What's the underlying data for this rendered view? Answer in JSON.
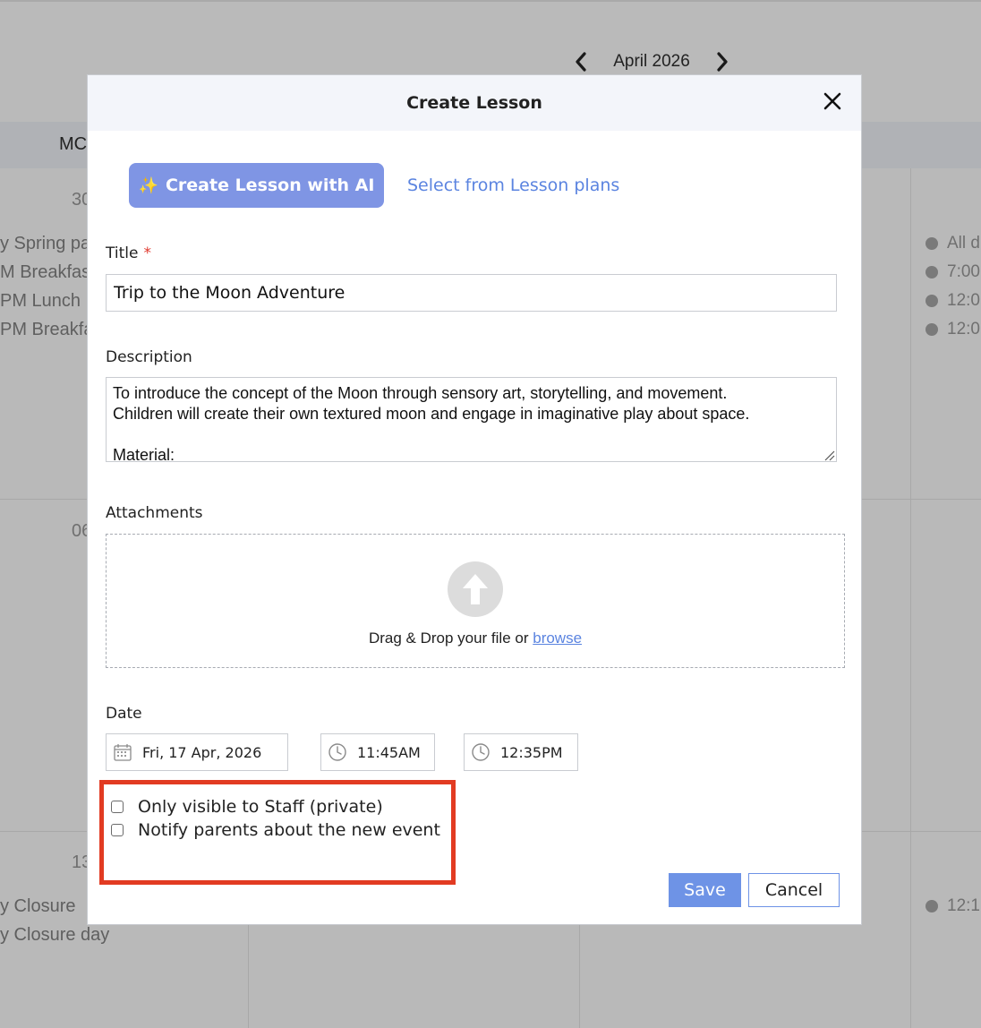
{
  "calendar": {
    "month_label": "April 2026",
    "prev_arrow": "‹",
    "next_arrow": "›",
    "day_of_week": "MC",
    "day_numbers": [
      "30",
      "06",
      "13"
    ],
    "left_events_week1": [
      "y Spring pa",
      "M Breakfas",
      "PM Lunch",
      "PM Breakfa"
    ],
    "right_events_week1": [
      "All d",
      "7:00",
      "12:0",
      "12:0"
    ],
    "left_events_week3": [
      "y Closure",
      "y Closure day"
    ],
    "right_events_week3": [
      "12:1"
    ]
  },
  "modal": {
    "title": "Create Lesson",
    "ai_button_icon": "✨",
    "ai_button_label": "Create Lesson with AI",
    "lesson_plans_link": "Select from Lesson plans",
    "title_label": "Title",
    "required_mark": "*",
    "title_value": "Trip to the Moon Adventure",
    "description_label": "Description",
    "description_value": "To introduce the concept of the Moon through sensory art, storytelling, and movement.\nChildren will create their own textured moon and engage in imaginative play about space.\n\nMaterial:",
    "attachments_label": "Attachments",
    "drop_text": "Drag & Drop your file or ",
    "browse_link": "browse",
    "date_label": "Date",
    "date_value": "Fri, 17 Apr, 2026",
    "start_time": "11:45AM",
    "end_time": "12:35PM",
    "checkbox_private": "Only visible to Staff (private)",
    "checkbox_notify": "Notify parents about the new event",
    "save_label": "Save",
    "cancel_label": "Cancel"
  },
  "icons": [
    "chevron-left-icon",
    "chevron-right-icon",
    "close-icon",
    "sparkle-icon",
    "upload-arrow-icon",
    "calendar-icon",
    "clock-icon",
    "resize-grip-icon"
  ],
  "colors": {
    "overlay": "#b9b9b9",
    "header_bg": "#f3f5fa",
    "ai_button": "#7f95e4",
    "link": "#5b84e0",
    "save_button": "#6e93e6",
    "highlight_border": "#e23b22",
    "required": "#e03a2f"
  }
}
